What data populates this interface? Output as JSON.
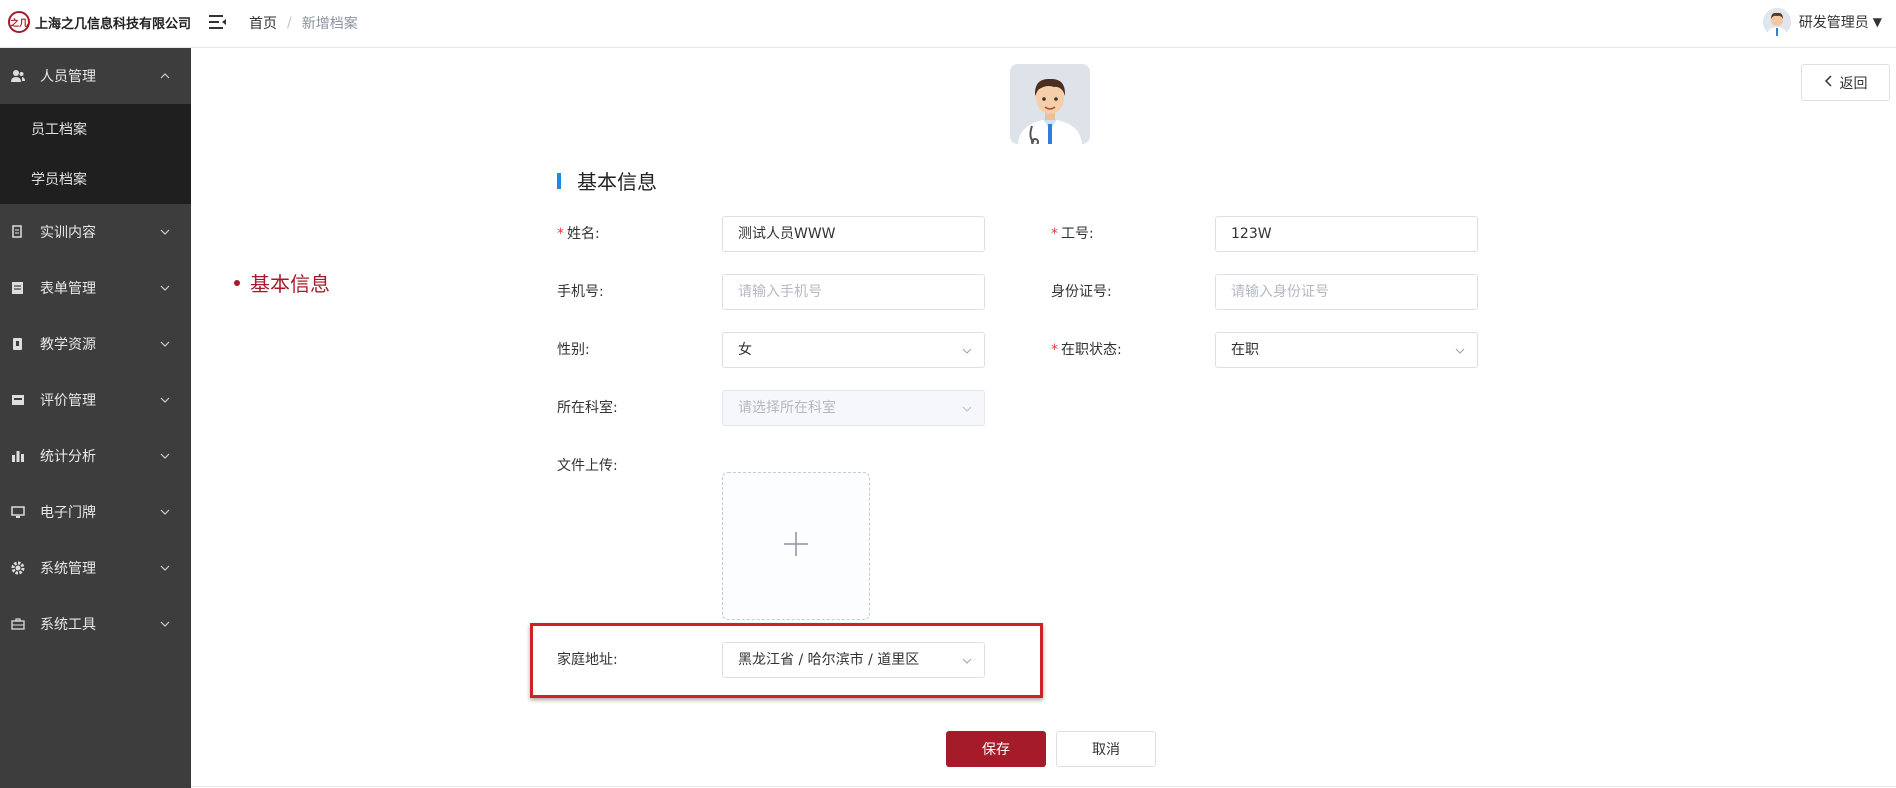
{
  "header": {
    "company_name": "上海之几信息科技有限公司",
    "logo_text": "之几",
    "breadcrumb": {
      "home": "首页",
      "separator": "/",
      "current": "新增档案"
    },
    "user": {
      "name": "研发管理员",
      "caret": "▼"
    }
  },
  "sidebar": {
    "items": [
      {
        "label": "人员管理",
        "icon": "users-icon",
        "expanded": true,
        "children": [
          {
            "label": "员工档案"
          },
          {
            "label": "学员档案"
          }
        ]
      },
      {
        "label": "实训内容",
        "icon": "document-icon"
      },
      {
        "label": "表单管理",
        "icon": "form-icon"
      },
      {
        "label": "教学资源",
        "icon": "resource-icon"
      },
      {
        "label": "评价管理",
        "icon": "evaluate-icon"
      },
      {
        "label": "统计分析",
        "icon": "bar-chart-icon"
      },
      {
        "label": "电子门牌",
        "icon": "monitor-icon"
      },
      {
        "label": "系统管理",
        "icon": "gear-icon"
      },
      {
        "label": "系统工具",
        "icon": "toolbox-icon"
      }
    ]
  },
  "main": {
    "back_button": "返回",
    "anchor": "基本信息",
    "section_title": "基本信息",
    "form": {
      "name": {
        "label": "姓名:",
        "required": "*",
        "value": "测试人员WWW"
      },
      "job_no": {
        "label": "工号:",
        "required": "*",
        "value": "123W"
      },
      "phone": {
        "label": "手机号:",
        "placeholder": "请输入手机号"
      },
      "id_card": {
        "label": "身份证号:",
        "placeholder": "请输入身份证号"
      },
      "gender": {
        "label": "性别:",
        "value": "女"
      },
      "status": {
        "label": "在职状态:",
        "required": "*",
        "value": "在职"
      },
      "department": {
        "label": "所在科室:",
        "placeholder": "请选择所在科室",
        "disabled": true
      },
      "upload": {
        "label": "文件上传:",
        "icon": "plus-icon"
      },
      "address": {
        "label": "家庭地址:",
        "value": "黑龙江省 / 哈尔滨市 / 道里区"
      }
    },
    "save_button": "保存",
    "cancel_button": "取消"
  },
  "colors": {
    "brand": "#a61b29",
    "sidebar_bg": "#3d3d3d",
    "submenu_bg": "#1f1f1f",
    "section_bar": "#1e88e5",
    "highlight": "#d0202a"
  }
}
